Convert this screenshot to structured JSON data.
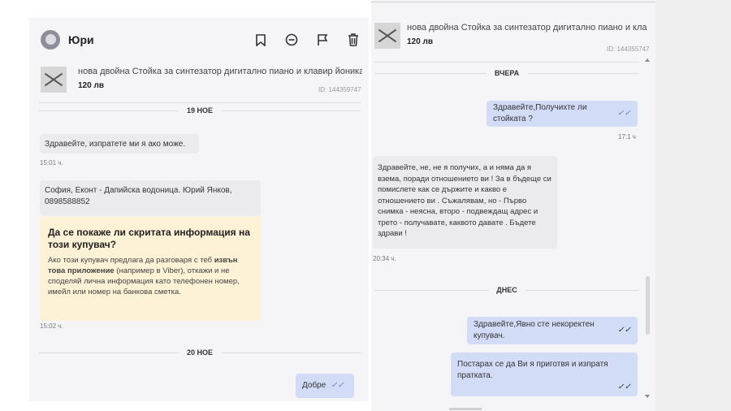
{
  "left": {
    "header": {
      "user_name": "Юри"
    },
    "listing": {
      "title": "нова двойна Стойка за синтезатор дигитално пиано и клавир йоника",
      "price": "120 лв",
      "id_label": "ID: 144359747"
    },
    "day1": "19 НОЕ",
    "msg1": {
      "text": "Здравейте, изпратете ми я ако може.",
      "time": "15:01 ч."
    },
    "msg2": {
      "text": "София, Еконт - Дапийска водоница. Юрий Янков, 0898588852"
    },
    "warning": {
      "title": "Да се покаже ли скритата информация на този купувач?",
      "body_before": "Ако този купувач предлага да разговаря с теб ",
      "body_bold": "извън това приложение",
      "body_after": " (например в Viber), откажи и не споделяй лична информация като телефонен номер, имейл или номер на банкова сметка."
    },
    "warning_time": "15:02 ч.",
    "day2": "20 НОЕ",
    "msg3": {
      "text": "Добре"
    }
  },
  "right": {
    "listing": {
      "title": "нова двойна Стойка за синтезатор дигитално пиано и клавир йон...",
      "price": "120 лв",
      "id_label": "ID: 144355747"
    },
    "day1": "ВЧЕРА",
    "msg1": {
      "text": "Здравейте,Получихте ли стойката ?",
      "time": "17:1 ч"
    },
    "msg2": {
      "text": "Здравейте, не, не я получих, а и няма да я взема, поради отношението ви ! За в бъдеще си помислете как се държите и какво е отношението ви . Съжалявам, но - Първо снимка - неясна, второ - подвеждащ адрес и трето - получавате, каквото давате . Бъдете здрави !",
      "time": "20:34 ч."
    },
    "day2": "ДНЕС",
    "msg3": {
      "text": "Здравейте,Явно сте некоректен купувач."
    },
    "msg4": {
      "text": "Постарах се да Ви я приготвя и изпратя пратката."
    }
  },
  "colors": {
    "outgoing_bubble": "#d3dcf7",
    "incoming_bubble": "#ebebee",
    "warning_bg": "#fdf1d6",
    "tick": "#6c7fc9"
  },
  "icons": [
    "bookmark-icon",
    "block-icon",
    "flag-icon",
    "trash-icon",
    "double-check-icon"
  ]
}
